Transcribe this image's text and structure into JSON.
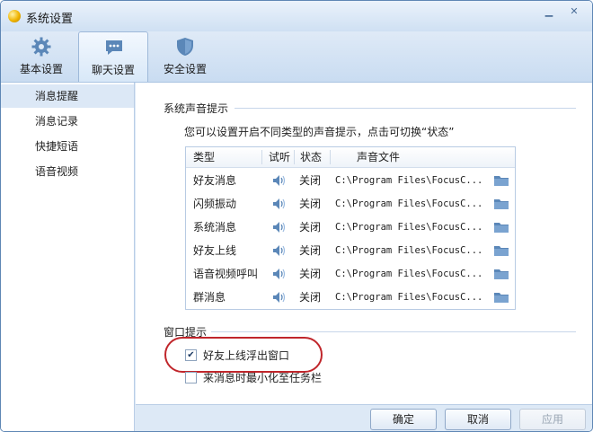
{
  "window": {
    "title": "系统设置"
  },
  "toolbar": {
    "tabs": [
      {
        "label": "基本设置",
        "icon": "gear-icon"
      },
      {
        "label": "聊天设置",
        "icon": "chat-icon",
        "active": true
      },
      {
        "label": "安全设置",
        "icon": "shield-icon"
      }
    ]
  },
  "sidebar": {
    "items": [
      {
        "label": "消息提醒",
        "active": true
      },
      {
        "label": "消息记录"
      },
      {
        "label": "快捷短语"
      },
      {
        "label": "语音视频"
      }
    ]
  },
  "sound": {
    "section_title": "系统声音提示",
    "hint": "您可以设置开启不同类型的声音提示，点击可切换“状态”",
    "columns": [
      "类型",
      "试听",
      "状态",
      "声音文件"
    ],
    "rows": [
      {
        "type": "好友消息",
        "status": "关闭",
        "file": "C:\\Program Files\\FocusC..."
      },
      {
        "type": "闪频振动",
        "status": "关闭",
        "file": "C:\\Program Files\\FocusC..."
      },
      {
        "type": "系统消息",
        "status": "关闭",
        "file": "C:\\Program Files\\FocusC..."
      },
      {
        "type": "好友上线",
        "status": "关闭",
        "file": "C:\\Program Files\\FocusC..."
      },
      {
        "type": "语音视频呼叫",
        "status": "关闭",
        "file": "C:\\Program Files\\FocusC..."
      },
      {
        "type": "群消息",
        "status": "关闭",
        "file": "C:\\Program Files\\FocusC..."
      }
    ]
  },
  "window_hint": {
    "section_title": "窗口提示",
    "options": [
      {
        "label": "好友上线浮出窗口",
        "checked": true
      },
      {
        "label": "来消息时最小化至任务栏",
        "checked": false
      }
    ]
  },
  "footer": {
    "ok": "确定",
    "cancel": "取消",
    "apply": "应用"
  },
  "colors": {
    "accent": "#5f87b5",
    "highlight": "#c0262b",
    "icon_blue": "#5b87b8"
  }
}
